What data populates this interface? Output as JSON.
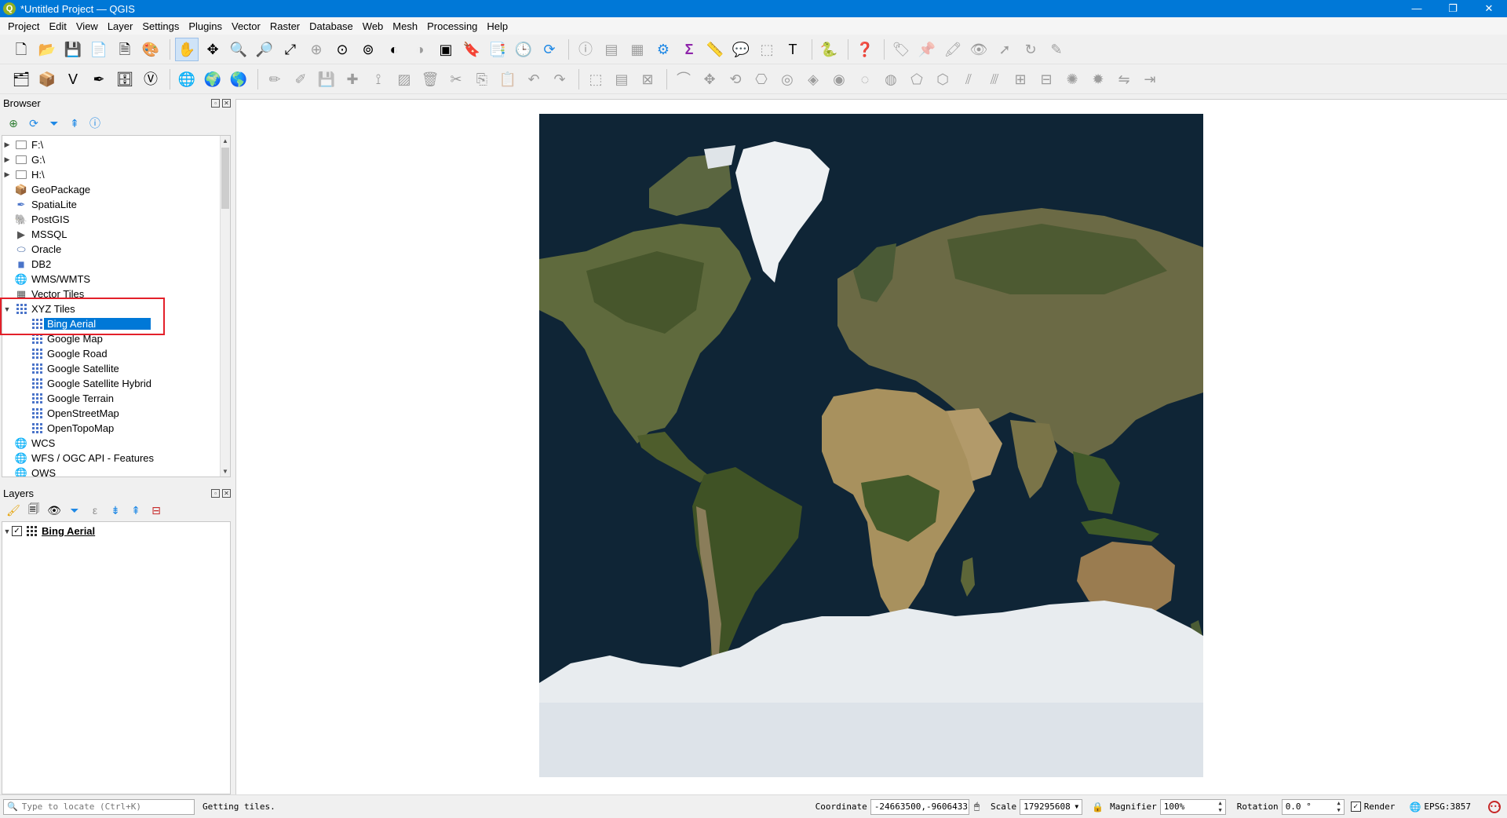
{
  "window": {
    "title": "*Untitled Project — QGIS",
    "app_icon": "qgis-icon",
    "controls": [
      "—",
      "❐",
      "✕"
    ]
  },
  "menubar": [
    "Project",
    "Edit",
    "View",
    "Layer",
    "Settings",
    "Plugins",
    "Vector",
    "Raster",
    "Database",
    "Web",
    "Mesh",
    "Processing",
    "Help"
  ],
  "browser": {
    "title": "Browser",
    "tree": [
      {
        "label": "F:\\",
        "icon": "folder-icon",
        "arrow": "▶"
      },
      {
        "label": "G:\\",
        "icon": "folder-icon",
        "arrow": "▶"
      },
      {
        "label": "H:\\",
        "icon": "folder-icon",
        "arrow": "▶"
      },
      {
        "label": "GeoPackage",
        "icon": "geopackage-icon"
      },
      {
        "label": "SpatiaLite",
        "icon": "spatialite-icon"
      },
      {
        "label": "PostGIS",
        "icon": "postgis-icon"
      },
      {
        "label": "MSSQL",
        "icon": "mssql-icon"
      },
      {
        "label": "Oracle",
        "icon": "oracle-icon"
      },
      {
        "label": "DB2",
        "icon": "db2-icon"
      },
      {
        "label": "WMS/WMTS",
        "icon": "wms-icon"
      },
      {
        "label": "Vector Tiles",
        "icon": "vector-tiles-icon"
      },
      {
        "label": "XYZ Tiles",
        "icon": "xyz-tiles-icon",
        "arrow": "▼"
      },
      {
        "label": "Bing Aerial",
        "icon": "xyz-tile-icon",
        "child": true,
        "selected": true
      },
      {
        "label": "Google Map",
        "icon": "xyz-tile-icon",
        "child": true
      },
      {
        "label": "Google Road",
        "icon": "xyz-tile-icon",
        "child": true
      },
      {
        "label": "Google Satellite",
        "icon": "xyz-tile-icon",
        "child": true
      },
      {
        "label": "Google Satellite Hybrid",
        "icon": "xyz-tile-icon",
        "child": true
      },
      {
        "label": "Google Terrain",
        "icon": "xyz-tile-icon",
        "child": true
      },
      {
        "label": "OpenStreetMap",
        "icon": "xyz-tile-icon",
        "child": true
      },
      {
        "label": "OpenTopoMap",
        "icon": "xyz-tile-icon",
        "child": true
      },
      {
        "label": "WCS",
        "icon": "wcs-icon"
      },
      {
        "label": "WFS / OGC API - Features",
        "icon": "wfs-icon"
      },
      {
        "label": "OWS",
        "icon": "ows-icon"
      }
    ]
  },
  "layers": {
    "title": "Layers",
    "items": [
      {
        "label": "Bing Aerial",
        "checked": "✓",
        "arrow": "▼"
      }
    ]
  },
  "statusbar": {
    "locator_placeholder": "Type to locate (Ctrl+K)",
    "message": "Getting tiles.",
    "coordinate_label": "Coordinate",
    "coordinate_value": "-24663500,-9606433",
    "scale_label": "Scale",
    "scale_value": "179295608",
    "magnifier_label": "Magnifier",
    "magnifier_value": "100%",
    "rotation_label": "Rotation",
    "rotation_value": "0.0 °",
    "render_label": "Render",
    "render_checked": "✓",
    "crs": "EPSG:3857"
  },
  "colors": {
    "titlebar": "#0078d7",
    "selection": "#0078d7",
    "highlight_box": "#e3202a",
    "ocean": "#0f2536",
    "ice": "#e8ecef"
  }
}
